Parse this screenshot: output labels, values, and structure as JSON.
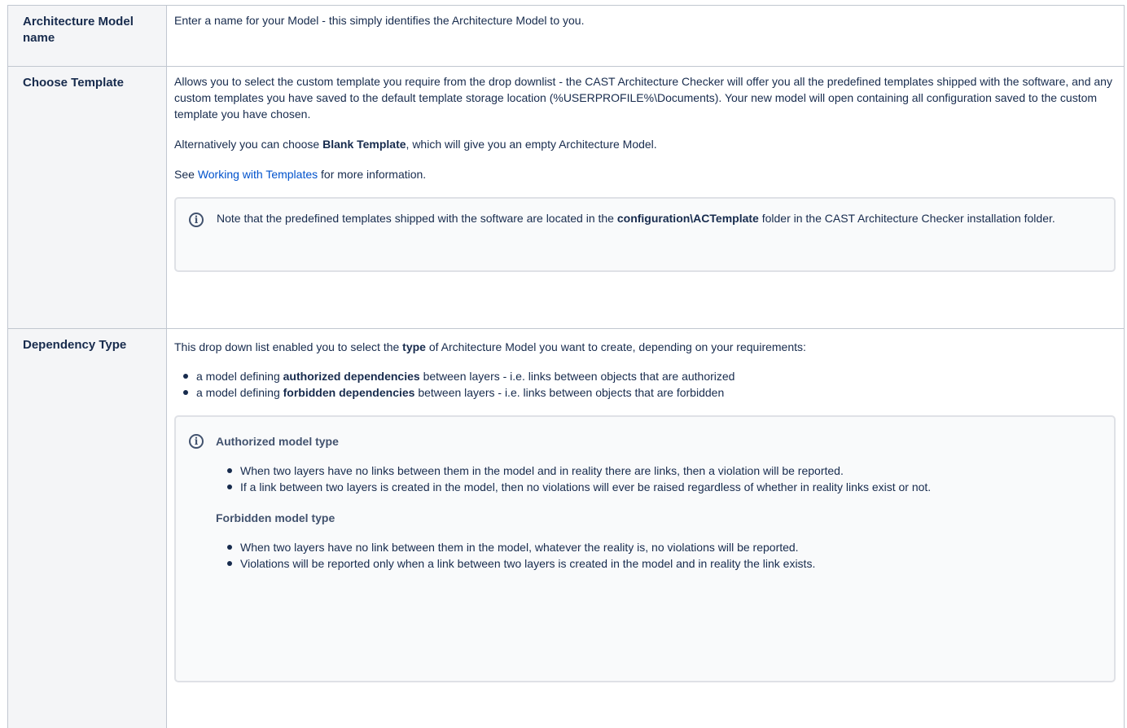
{
  "rows": [
    {
      "label": "Architecture Model name",
      "text": "Enter a name for your Model - this simply identifies the Architecture Model to you."
    },
    {
      "label": "Choose Template",
      "para1": "Allows you to select the custom template you require from the drop downlist - the CAST Architecture Checker will offer you all the predefined templates shipped with the software, and any custom templates you have saved to the default template storage location (%USERPROFILE%\\Documents). Your new model will open containing all configuration saved to the custom template you have chosen.",
      "para2_pre": "Alternatively you can choose ",
      "para2_bold": "Blank Template",
      "para2_post": ", which will give you an empty Architecture Model.",
      "see_pre": "See ",
      "see_link": "Working with Templates",
      "see_post": " for more information.",
      "note_pre": "Note that the predefined templates shipped with the software are located in the ",
      "note_bold": "configuration\\ACTemplate",
      "note_post": " folder in the CAST Architecture Checker installation folder."
    },
    {
      "label": "Dependency Type",
      "intro_pre": "This drop down list enabled you to select the ",
      "intro_bold": "type",
      "intro_post": " of Architecture Model you want to create, depending on your requirements:",
      "bullets": [
        {
          "pre": "a model defining ",
          "bold": "authorized dependencies",
          "post": " between layers - i.e. links between objects that are authorized"
        },
        {
          "pre": "a model defining ",
          "bold": "forbidden dependencies",
          "post": " between layers - i.e. links between objects that are forbidden"
        }
      ],
      "authorized_title": "Authorized model type",
      "authorized_items": [
        "When two layers have no links between them in the model and in reality there are links, then a violation will be reported.",
        "If a link between two layers is created in the model, then no violations will ever be raised regardless of whether in reality links exist or not."
      ],
      "forbidden_title": "Forbidden model type",
      "forbidden_items": [
        "When two layers have no link between them in the model, whatever the reality is, no violations will be reported.",
        "Violations will be reported only when a link between two layers is created in the model and in reality the link exists."
      ]
    }
  ],
  "icons": {
    "info": "info-icon"
  },
  "colors": {
    "link": "#0052cc",
    "header_bg": "#f4f5f7",
    "border": "#c1c7d0"
  }
}
